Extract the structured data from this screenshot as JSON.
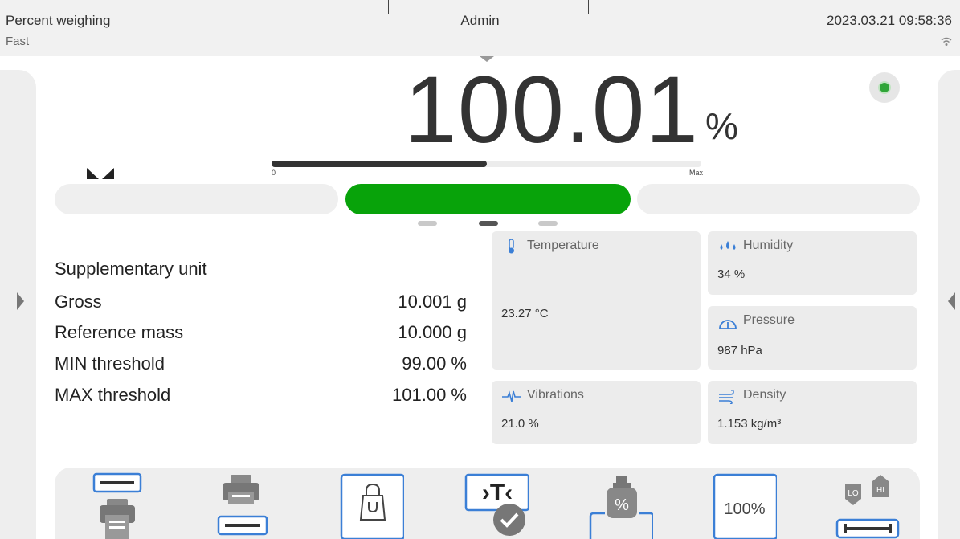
{
  "header": {
    "mode": "Percent weighing",
    "speed": "Fast",
    "user": "Admin",
    "datetime": "2023.03.21 09:58:36"
  },
  "reading": {
    "value": "100.01",
    "unit": "%"
  },
  "range_bar": {
    "min_label": "0",
    "max_label": "Max",
    "fill_fraction": 0.5
  },
  "thresholds": {
    "active": "ok",
    "colors": {
      "ok": "#08a30a",
      "inactive": "#efefef"
    }
  },
  "pages": {
    "count": 3,
    "active": 1
  },
  "info": {
    "heading": "Supplementary unit",
    "rows": [
      {
        "label": "Gross",
        "value": "10.001 g"
      },
      {
        "label": "Reference mass",
        "value": "10.000 g"
      },
      {
        "label": "MIN threshold",
        "value": "99.00 %"
      },
      {
        "label": "MAX threshold",
        "value": "101.00 %"
      }
    ]
  },
  "environment": {
    "temperature": {
      "label": "Temperature",
      "value": "23.27 °C",
      "icon": "thermometer-icon"
    },
    "humidity": {
      "label": "Humidity",
      "value": "34 %",
      "icon": "drops-icon"
    },
    "pressure": {
      "label": "Pressure",
      "value": "987 hPa",
      "icon": "gauge-icon"
    },
    "vibrations": {
      "label": "Vibrations",
      "value": "21.0 %",
      "icon": "pulse-icon"
    },
    "density": {
      "label": "Density",
      "value": "1.153 kg/m³",
      "icon": "wind-icon"
    }
  },
  "toolbar": {
    "buttons": [
      {
        "name": "print-header-button",
        "icon": "printer-header-icon"
      },
      {
        "name": "print-footer-button",
        "icon": "printer-footer-icon"
      },
      {
        "name": "tare-container-button",
        "icon": "bag-icon"
      },
      {
        "name": "tare-button",
        "icon": "tare-check-icon"
      },
      {
        "name": "reference-mass-button",
        "icon": "weight-percent-icon"
      },
      {
        "name": "set-100-percent-button",
        "icon": "percent-100-icon",
        "label": "100%"
      },
      {
        "name": "thresholds-button",
        "icon": "lo-hi-icon",
        "lo": "LO",
        "hi": "HI"
      }
    ]
  },
  "accent_color": "#3b7fd6"
}
